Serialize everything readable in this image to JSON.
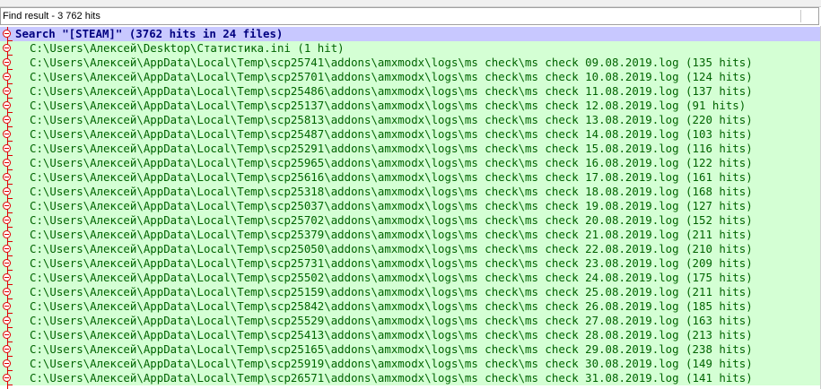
{
  "panel": {
    "title": "Find result - 3 762 hits"
  },
  "search": {
    "label": "Search \"[STEAM]\" (3762 hits in 24 files)"
  },
  "files": [
    "C:\\Users\\Алексей\\Desktop\\Статистика.ini (1 hit)",
    "C:\\Users\\Алексей\\AppData\\Local\\Temp\\scp25741\\addons\\amxmodx\\logs\\ms check\\ms check 09.08.2019.log (135 hits)",
    "C:\\Users\\Алексей\\AppData\\Local\\Temp\\scp25701\\addons\\amxmodx\\logs\\ms check\\ms check 10.08.2019.log (124 hits)",
    "C:\\Users\\Алексей\\AppData\\Local\\Temp\\scp25486\\addons\\amxmodx\\logs\\ms check\\ms check 11.08.2019.log (137 hits)",
    "C:\\Users\\Алексей\\AppData\\Local\\Temp\\scp25137\\addons\\amxmodx\\logs\\ms check\\ms check 12.08.2019.log (91 hits)",
    "C:\\Users\\Алексей\\AppData\\Local\\Temp\\scp25813\\addons\\amxmodx\\logs\\ms check\\ms check 13.08.2019.log (220 hits)",
    "C:\\Users\\Алексей\\AppData\\Local\\Temp\\scp25487\\addons\\amxmodx\\logs\\ms check\\ms check 14.08.2019.log (103 hits)",
    "C:\\Users\\Алексей\\AppData\\Local\\Temp\\scp25291\\addons\\amxmodx\\logs\\ms check\\ms check 15.08.2019.log (116 hits)",
    "C:\\Users\\Алексей\\AppData\\Local\\Temp\\scp25965\\addons\\amxmodx\\logs\\ms check\\ms check 16.08.2019.log (122 hits)",
    "C:\\Users\\Алексей\\AppData\\Local\\Temp\\scp25616\\addons\\amxmodx\\logs\\ms check\\ms check 17.08.2019.log (161 hits)",
    "C:\\Users\\Алексей\\AppData\\Local\\Temp\\scp25318\\addons\\amxmodx\\logs\\ms check\\ms check 18.08.2019.log (168 hits)",
    "C:\\Users\\Алексей\\AppData\\Local\\Temp\\scp25037\\addons\\amxmodx\\logs\\ms check\\ms check 19.08.2019.log (127 hits)",
    "C:\\Users\\Алексей\\AppData\\Local\\Temp\\scp25702\\addons\\amxmodx\\logs\\ms check\\ms check 20.08.2019.log (152 hits)",
    "C:\\Users\\Алексей\\AppData\\Local\\Temp\\scp25379\\addons\\amxmodx\\logs\\ms check\\ms check 21.08.2019.log (211 hits)",
    "C:\\Users\\Алексей\\AppData\\Local\\Temp\\scp25050\\addons\\amxmodx\\logs\\ms check\\ms check 22.08.2019.log (210 hits)",
    "C:\\Users\\Алексей\\AppData\\Local\\Temp\\scp25731\\addons\\amxmodx\\logs\\ms check\\ms check 23.08.2019.log (209 hits)",
    "C:\\Users\\Алексей\\AppData\\Local\\Temp\\scp25502\\addons\\amxmodx\\logs\\ms check\\ms check 24.08.2019.log (175 hits)",
    "C:\\Users\\Алексей\\AppData\\Local\\Temp\\scp25159\\addons\\amxmodx\\logs\\ms check\\ms check 25.08.2019.log (211 hits)",
    "C:\\Users\\Алексей\\AppData\\Local\\Temp\\scp25842\\addons\\amxmodx\\logs\\ms check\\ms check 26.08.2019.log (185 hits)",
    "C:\\Users\\Алексей\\AppData\\Local\\Temp\\scp25529\\addons\\amxmodx\\logs\\ms check\\ms check 27.08.2019.log (163 hits)",
    "C:\\Users\\Алексей\\AppData\\Local\\Temp\\scp25413\\addons\\amxmodx\\logs\\ms check\\ms check 28.08.2019.log (213 hits)",
    "C:\\Users\\Алексей\\AppData\\Local\\Temp\\scp25165\\addons\\amxmodx\\logs\\ms check\\ms check 29.08.2019.log (238 hits)",
    "C:\\Users\\Алексей\\AppData\\Local\\Temp\\scp25919\\addons\\amxmodx\\logs\\ms check\\ms check 30.08.2019.log (149 hits)",
    "C:\\Users\\Алексей\\AppData\\Local\\Temp\\scp26571\\addons\\amxmodx\\logs\\ms check\\ms check 31.08.2019.log (141 hits)"
  ],
  "colors": {
    "search_bg": "#c8c8ff",
    "search_fg": "#000080",
    "file_bg": "#d4ffd4",
    "file_fg": "#006400",
    "fold_marker": "#e00000"
  },
  "icons": {
    "fold": "fold-collapse-icon"
  }
}
